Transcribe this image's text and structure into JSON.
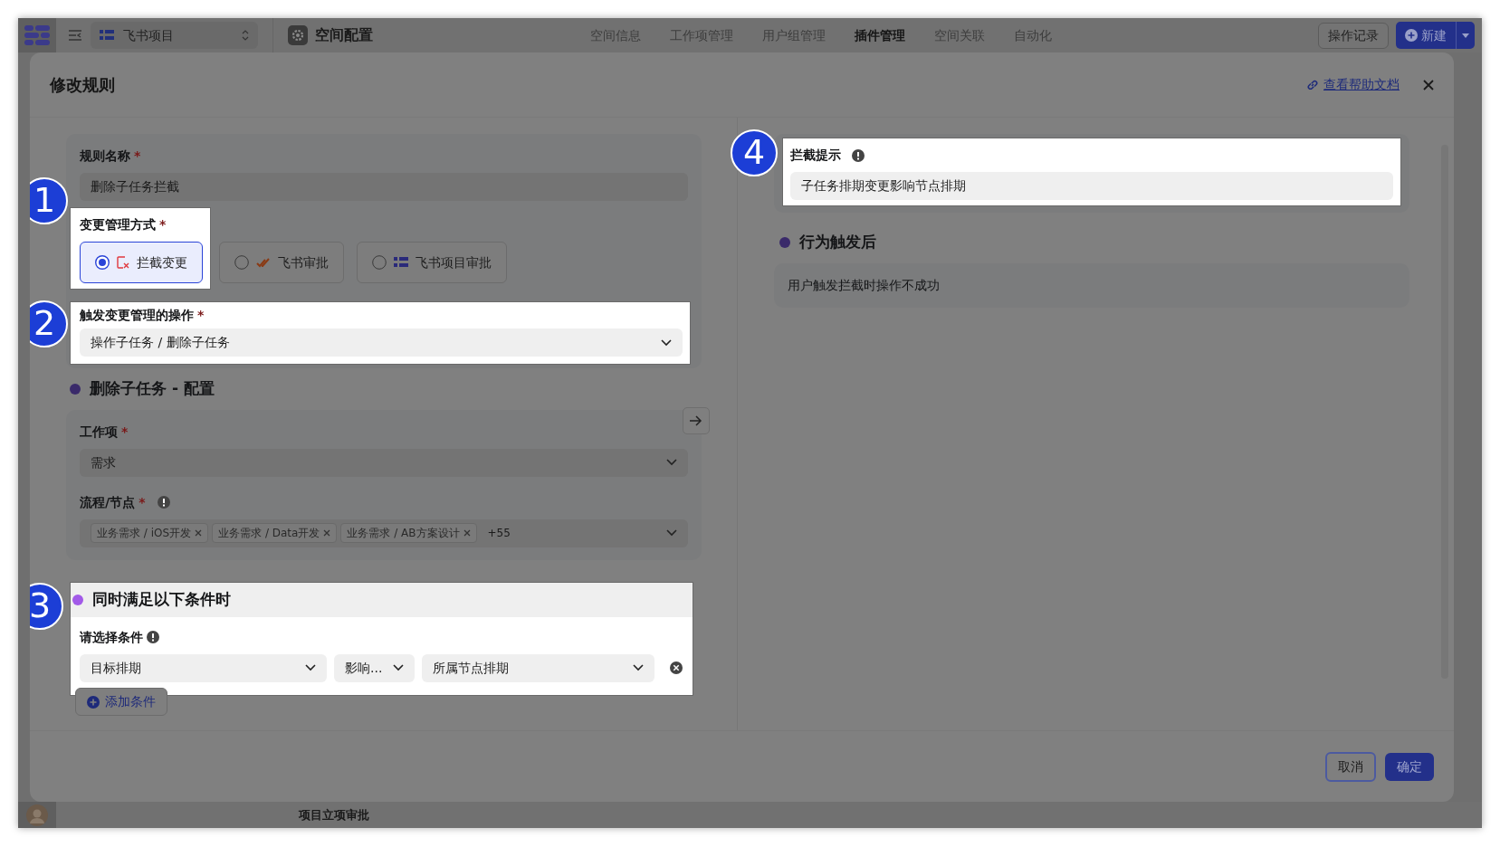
{
  "app": {
    "project_select": "飞书项目",
    "page_title": "空间配置",
    "nav": [
      {
        "label": "空间信息",
        "selected": false
      },
      {
        "label": "工作项管理",
        "selected": false
      },
      {
        "label": "用户组管理",
        "selected": false
      },
      {
        "label": "插件管理",
        "selected": true
      },
      {
        "label": "空间关联",
        "selected": false
      },
      {
        "label": "自动化",
        "selected": false
      }
    ],
    "history_button": "操作记录",
    "new_button": "新建",
    "background_row": "项目立项审批"
  },
  "dialog": {
    "title": "修改规则",
    "help_link": "查看帮助文档",
    "rule_name": {
      "label": "规则名称",
      "required_mark": "*",
      "value": "删除子任务拦截"
    },
    "mode": {
      "badge": "1",
      "label": "变更管理方式",
      "required_mark": "*",
      "options": [
        {
          "label": "拦截变更",
          "selected": true,
          "kind": "block"
        },
        {
          "label": "飞书审批",
          "selected": false,
          "kind": "approval"
        },
        {
          "label": "飞书项目审批",
          "selected": false,
          "kind": "project"
        }
      ]
    },
    "trigger": {
      "badge": "2",
      "label": "触发变更管理的操作",
      "required_mark": "*",
      "value": "操作子任务 / 删除子任务"
    },
    "config": {
      "heading": "删除子任务 - 配置",
      "work_item": {
        "label": "工作项",
        "required_mark": "*",
        "value": "需求"
      },
      "flow": {
        "label": "流程/节点",
        "required_mark": "*",
        "tags": [
          "业务需求 / iOS开发",
          "业务需求 / Data开发",
          "业务需求 / AB方案设计"
        ],
        "more": "+55"
      }
    },
    "conditions": {
      "badge": "3",
      "heading": "同时满足以下条件时",
      "label": "请选择条件",
      "field": "目标排期",
      "operator": "影响...",
      "target": "所属节点排期",
      "add_button": "添加条件"
    },
    "intercept": {
      "badge": "4",
      "label": "拦截提示",
      "value": "子任务排期变更影响节点排期"
    },
    "after": {
      "heading": "行为触发后",
      "text": "用户触发拦截时操作不成功"
    },
    "cancel_button": "取消",
    "confirm_button": "确定"
  }
}
